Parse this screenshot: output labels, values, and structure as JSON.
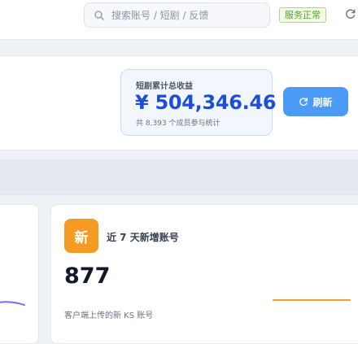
{
  "topbar": {
    "search_placeholder": "搜索账号 / 短剧 / 反馈",
    "search_value": "",
    "status_badge": "服务正常",
    "refresh_icon": "refresh-icon"
  },
  "header": {
    "earnings": {
      "label": "短剧累计总收益",
      "amount": "¥ 504,346.46",
      "note": "共 8,393 个成员参与统计"
    },
    "refresh_button": {
      "label": "刷新",
      "icon": "refresh-icon"
    }
  },
  "stat_card": {
    "badge": "新",
    "title": "近 7 天新增账号",
    "value": "877",
    "description": "客户端上传的新 KS 账号"
  },
  "colors": {
    "accent_blue": "#4a9bf5",
    "amount_blue": "#1d4ed8",
    "status_green": "#52a51c",
    "badge_orange": "#f59a23",
    "sparkline_purple": "#7c6cf0"
  }
}
